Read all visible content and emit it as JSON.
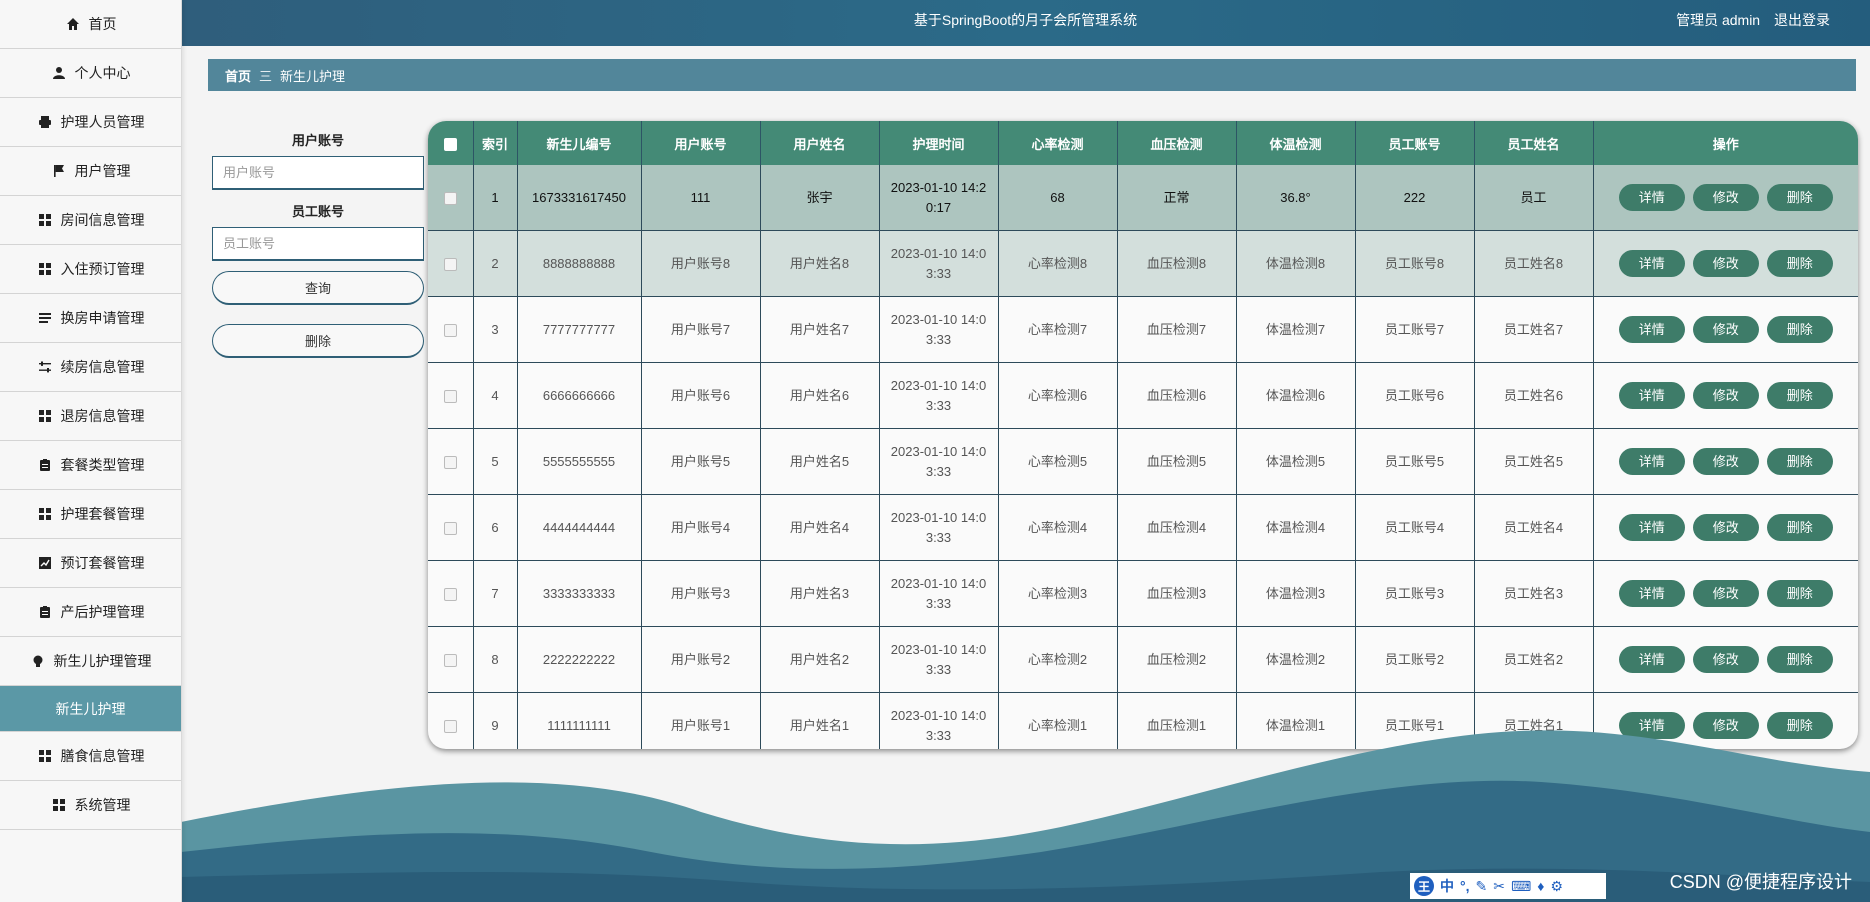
{
  "header": {
    "title": "基于SpringBoot的月子会所管理系统",
    "user_label": "管理员 admin",
    "logout_label": "退出登录"
  },
  "sidebar": {
    "items": [
      {
        "label": "首页",
        "icon": "home-icon"
      },
      {
        "label": "个人中心",
        "icon": "user-icon"
      },
      {
        "label": "护理人员管理",
        "icon": "printer-icon"
      },
      {
        "label": "用户管理",
        "icon": "flag-icon"
      },
      {
        "label": "房间信息管理",
        "icon": "grid-icon"
      },
      {
        "label": "入住预订管理",
        "icon": "grid-icon"
      },
      {
        "label": "换房申请管理",
        "icon": "list-icon"
      },
      {
        "label": "续房信息管理",
        "icon": "sliders-icon"
      },
      {
        "label": "退房信息管理",
        "icon": "grid-icon"
      },
      {
        "label": "套餐类型管理",
        "icon": "clipboard-icon"
      },
      {
        "label": "护理套餐管理",
        "icon": "grid-icon"
      },
      {
        "label": "预订套餐管理",
        "icon": "chart-icon"
      },
      {
        "label": "产后护理管理",
        "icon": "clipboard-icon"
      },
      {
        "label": "新生儿护理管理",
        "icon": "bulb-icon"
      }
    ],
    "active_sub": "新生儿护理",
    "after_items": [
      {
        "label": "膳食信息管理",
        "icon": "grid-icon"
      },
      {
        "label": "系统管理",
        "icon": "grid-icon"
      }
    ]
  },
  "breadcrumb": {
    "home": "首页",
    "separator": "三",
    "current": "新生儿护理"
  },
  "search": {
    "user_account_label": "用户账号",
    "user_account_placeholder": "用户账号",
    "staff_account_label": "员工账号",
    "staff_account_placeholder": "员工账号",
    "query_button": "查询",
    "delete_button": "删除"
  },
  "table": {
    "headers": [
      "索引",
      "新生儿编号",
      "用户账号",
      "用户姓名",
      "护理时间",
      "心率检测",
      "血压检测",
      "体温检测",
      "员工账号",
      "员工姓名",
      "操作"
    ],
    "actions": {
      "detail": "详情",
      "edit": "修改",
      "delete": "删除"
    },
    "rows": [
      [
        "1",
        "1673331617450",
        "111",
        "张宇",
        "2023-01-10 14:20:17",
        "68",
        "正常",
        "36.8°",
        "222",
        "员工"
      ],
      [
        "2",
        "8888888888",
        "用户账号8",
        "用户姓名8",
        "2023-01-10 14:03:33",
        "心率检测8",
        "血压检测8",
        "体温检测8",
        "员工账号8",
        "员工姓名8"
      ],
      [
        "3",
        "7777777777",
        "用户账号7",
        "用户姓名7",
        "2023-01-10 14:03:33",
        "心率检测7",
        "血压检测7",
        "体温检测7",
        "员工账号7",
        "员工姓名7"
      ],
      [
        "4",
        "6666666666",
        "用户账号6",
        "用户姓名6",
        "2023-01-10 14:03:33",
        "心率检测6",
        "血压检测6",
        "体温检测6",
        "员工账号6",
        "员工姓名6"
      ],
      [
        "5",
        "5555555555",
        "用户账号5",
        "用户姓名5",
        "2023-01-10 14:03:33",
        "心率检测5",
        "血压检测5",
        "体温检测5",
        "员工账号5",
        "员工姓名5"
      ],
      [
        "6",
        "4444444444",
        "用户账号4",
        "用户姓名4",
        "2023-01-10 14:03:33",
        "心率检测4",
        "血压检测4",
        "体温检测4",
        "员工账号4",
        "员工姓名4"
      ],
      [
        "7",
        "3333333333",
        "用户账号3",
        "用户姓名3",
        "2023-01-10 14:03:33",
        "心率检测3",
        "血压检测3",
        "体温检测3",
        "员工账号3",
        "员工姓名3"
      ],
      [
        "8",
        "2222222222",
        "用户账号2",
        "用户姓名2",
        "2023-01-10 14:03:33",
        "心率检测2",
        "血压检测2",
        "体温检测2",
        "员工账号2",
        "员工姓名2"
      ],
      [
        "9",
        "1111111111",
        "用户账号1",
        "用户姓名1",
        "2023-01-10 14:03:33",
        "心率检测1",
        "血压检测1",
        "体温检测1",
        "员工账号1",
        "员工姓名1"
      ]
    ]
  },
  "ime_bar": {
    "brand": "王",
    "mode": "中"
  },
  "watermark": "CSDN @便捷程序设计",
  "colors": {
    "header_bg": "#2b6a88",
    "breadcrumb_bg": "#52869a",
    "table_header_bg": "#448a76",
    "action_button_bg": "#3e7c69",
    "active_menu_bg": "#5b98a6"
  }
}
